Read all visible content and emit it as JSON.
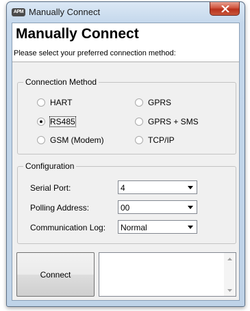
{
  "window": {
    "app_icon_text": "APM",
    "title": "Manually Connect",
    "close_icon": "close-x-icon"
  },
  "header": {
    "title": "Manually Connect",
    "subtitle": "Please select your preferred connection method:"
  },
  "connection_method": {
    "legend": "Connection Method",
    "options": [
      {
        "label": "HART",
        "selected": false
      },
      {
        "label": "GPRS",
        "selected": false
      },
      {
        "label": "RS485",
        "selected": true
      },
      {
        "label": "GPRS + SMS",
        "selected": false
      },
      {
        "label": "GSM (Modem)",
        "selected": false
      },
      {
        "label": "TCP/IP",
        "selected": false
      }
    ]
  },
  "configuration": {
    "legend": "Configuration",
    "serial_port": {
      "label": "Serial Port:",
      "value": "4"
    },
    "polling_address": {
      "label": "Polling Address:",
      "value": "00"
    },
    "communication_log": {
      "label": "Communication Log:",
      "value": "Normal"
    }
  },
  "actions": {
    "connect_label": "Connect"
  },
  "log": {
    "text": ""
  },
  "colors": {
    "window_frame": "#bfd3e8",
    "close_button": "#c9563c",
    "client_bg": "#f0f0f0"
  }
}
